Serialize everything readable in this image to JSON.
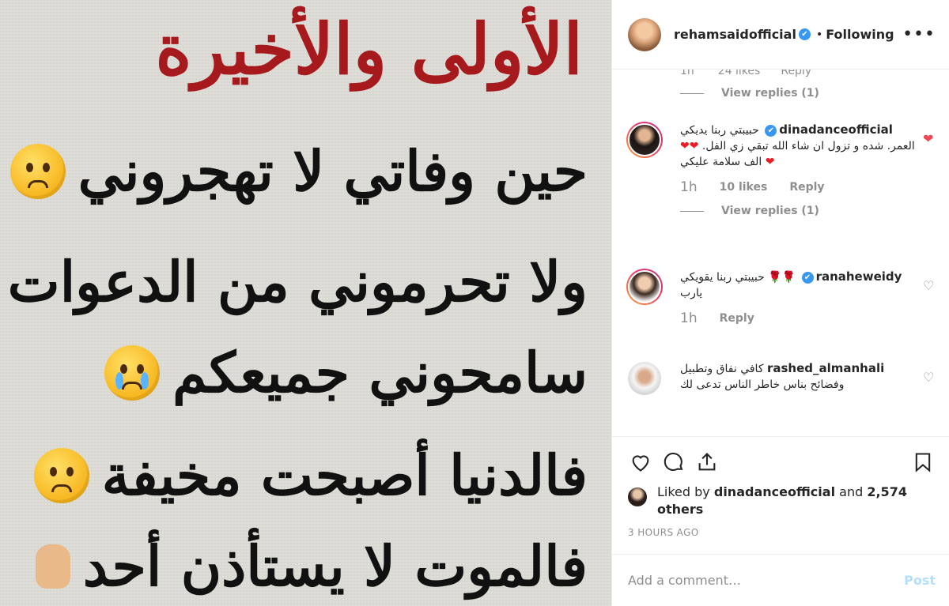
{
  "image": {
    "title": "الأولى والأخيرة",
    "lines": [
      "حين وفاتي لا تهجروني",
      "ولا تحرموني من الدعوات",
      "سامحوني جميعكم",
      "فالدنيا أصبحت مخيفة",
      "فالموت لا يستأذن أحد"
    ],
    "title_color": "#a61a1d"
  },
  "header": {
    "username": "rehamsaidofficial",
    "verified": "✔",
    "separator": "•",
    "follow_status": "Following",
    "more": "•••"
  },
  "partial_comment": {
    "time": "1h",
    "likes": "24 likes",
    "reply": "Reply",
    "view_replies": "View replies (1)"
  },
  "comments": [
    {
      "username": "dinadanceofficial",
      "verified": "✔",
      "text_before_hearts": "حبيبتي ربنا يديكي العمر. شده و تزول ان شاء الله تبقي زي الفل.",
      "hearts": "❤❤❤",
      "text_after_hearts": "الف سلامة عليكي",
      "time": "1h",
      "likes": "10 likes",
      "reply": "Reply",
      "view_replies": "View replies (1)",
      "liked": true
    },
    {
      "username": "ranaheweidy",
      "verified": "✔",
      "roses": "🌹🌹",
      "text": "حبيبتي ربنا يقويكي يارب",
      "time": "1h",
      "reply": "Reply",
      "liked": false
    },
    {
      "username": "rashed_almanhali",
      "text": "كافي نفاق وتطبيل وفضائح بناس خاطر الناس تدعى لك",
      "liked": false
    }
  ],
  "likes": {
    "prefix": "Liked by",
    "user": "dinadanceofficial",
    "and": "and",
    "count": "2,574 others"
  },
  "timestamp": "3 HOURS AGO",
  "add_comment": {
    "placeholder": "Add a comment…",
    "post": "Post"
  },
  "colors": {
    "accent": "#3897f0",
    "like_red": "#ed4956",
    "muted": "#8e8e8e"
  }
}
